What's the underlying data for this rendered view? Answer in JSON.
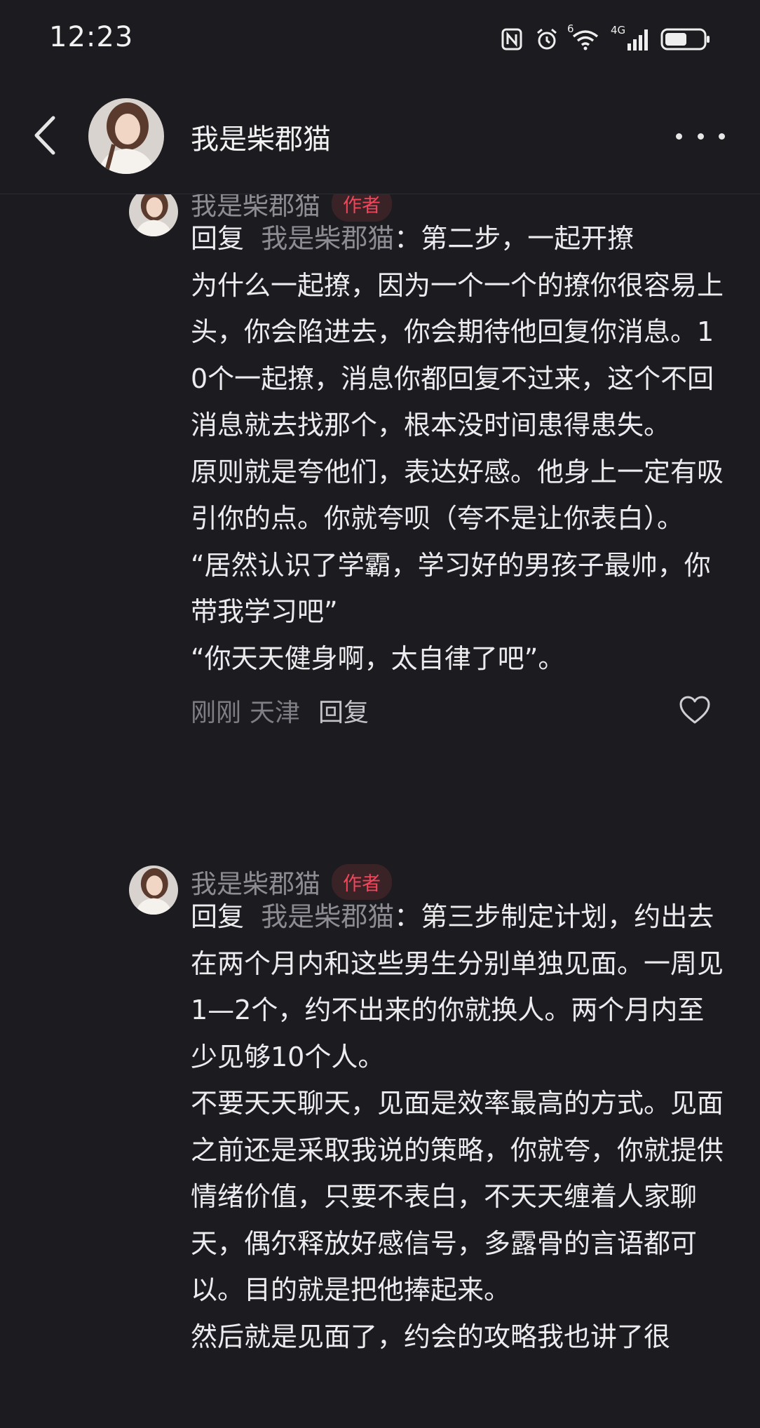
{
  "status_bar": {
    "time": "12:23",
    "icons": [
      "nfc-icon",
      "alarm-icon",
      "wifi-icon",
      "signal-4g-icon",
      "battery-icon"
    ],
    "wifi_badge": "6",
    "network_label": "4G"
  },
  "header": {
    "title": "我是柴郡猫",
    "back_icon": "chevron-left-icon",
    "more_icon": "more-horizontal-icon"
  },
  "comments": [
    {
      "author": "我是柴郡猫",
      "badge": "作者",
      "reply_prefix": "回复",
      "reply_target": "我是柴郡猫",
      "text": "：第二步，一起开撩\n为什么一起撩，因为一个一个的撩你很容易上头，你会陷进去，你会期待他回复你消息。10个一起撩，消息你都回复不过来，这个不回消息就去找那个，根本没时间患得患失。\n原则就是夸他们，表达好感。他身上一定有吸引你的点。你就夸呗（夸不是让你表白）。\n“居然认识了学霸，学习好的男孩子最帅，你带我学习吧”\n“你天天健身啊，太自律了吧”。",
      "time": "刚刚",
      "location": "天津",
      "reply_label": "回复"
    },
    {
      "author": "我是柴郡猫",
      "badge": "作者",
      "reply_prefix": "回复",
      "reply_target": "我是柴郡猫",
      "text": "：第三步制定计划，约出去\n在两个月内和这些男生分别单独见面。一周见1—2个，约不出来的你就换人。两个月内至少见够10个人。\n不要天天聊天，见面是效率最高的方式。见面之前还是采取我说的策略，你就夸，你就提供情绪价值，只要不表白，不天天缠着人家聊天，偶尔释放好感信号，多露骨的言语都可以。目的就是把他捧起来。\n然后就是见面了，约会的攻略我也讲了很"
    }
  ],
  "colors": {
    "background": "#1b1b20",
    "badge_text": "#f0465a",
    "badge_bg": "#3a2327",
    "muted_text": "#8c8c92"
  }
}
